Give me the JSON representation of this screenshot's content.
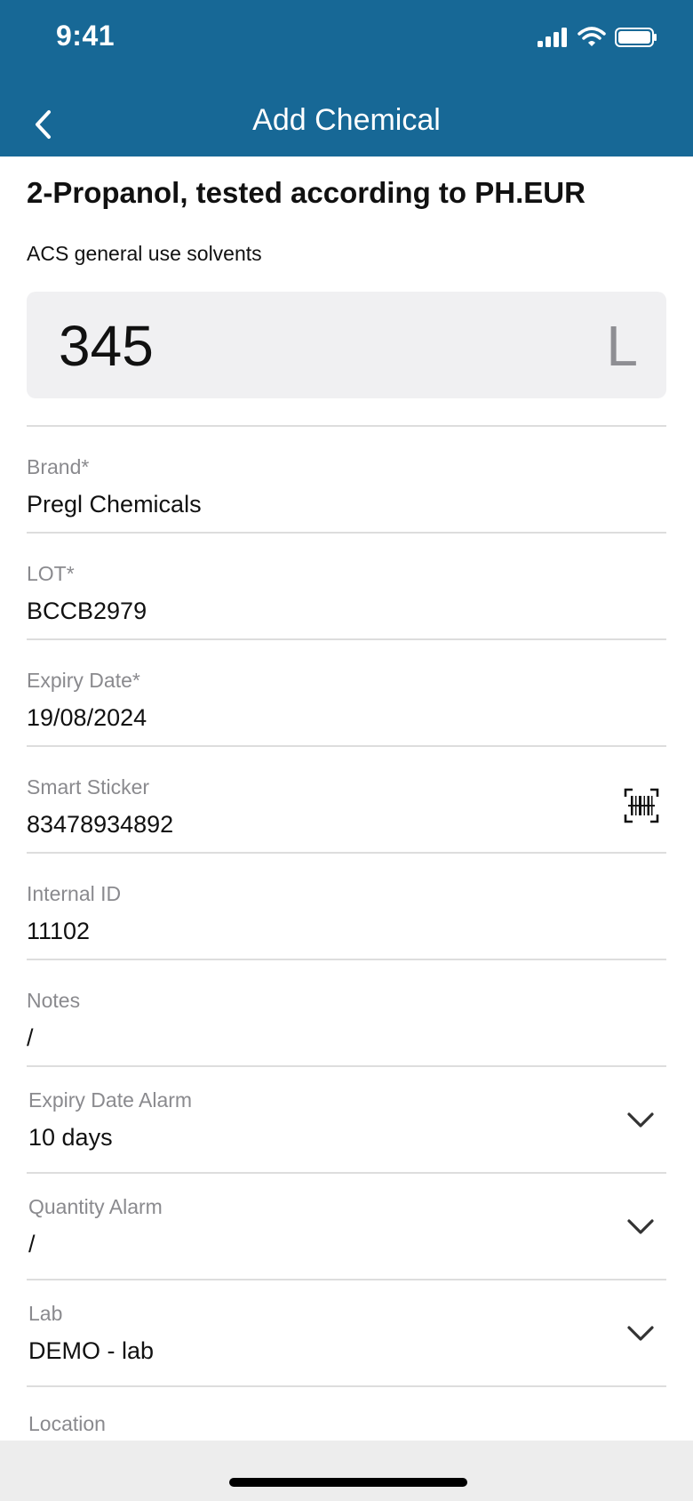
{
  "status": {
    "time": "9:41"
  },
  "nav": {
    "title": "Add Chemical"
  },
  "chemical": {
    "name": "2-Propanol, tested according to PH.EUR",
    "category": "ACS general use solvents",
    "quantity": "345",
    "unit": "L"
  },
  "fields": {
    "brand": {
      "label": "Brand*",
      "value": "Pregl Chemicals"
    },
    "lot": {
      "label": "LOT*",
      "value": "BCCB2979"
    },
    "expiry_date": {
      "label": "Expiry Date*",
      "value": "19/08/2024"
    },
    "smart_sticker": {
      "label": "Smart Sticker",
      "value": "83478934892",
      "icon": "barcode-scan-icon"
    },
    "internal_id": {
      "label": "Internal ID",
      "value": "11102"
    },
    "notes": {
      "label": "Notes",
      "value": "/"
    },
    "expiry_alarm": {
      "label": "Expiry Date Alarm",
      "value": "10 days"
    },
    "quantity_alarm": {
      "label": "Quantity Alarm",
      "value": "/"
    },
    "lab": {
      "label": "Lab",
      "value": "DEMO - lab"
    },
    "location": {
      "label": "Location"
    }
  },
  "colors": {
    "header": "#176896",
    "divider": "#dddddd",
    "label": "#8a8a8e",
    "input_bg": "#f0f0f2"
  }
}
